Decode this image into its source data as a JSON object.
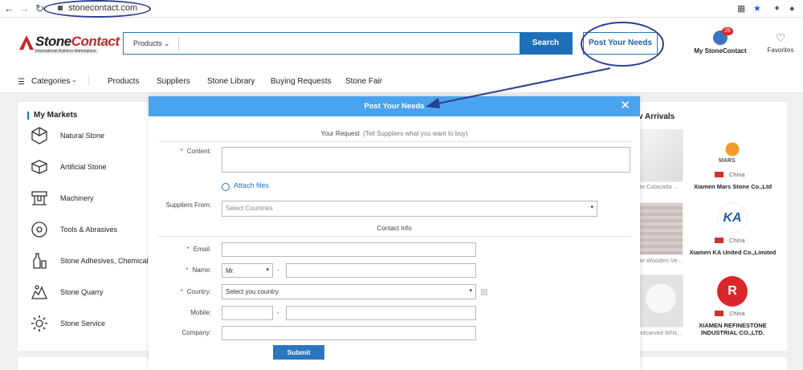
{
  "browser": {
    "url": "stonecontact.com",
    "back": "←",
    "forward": "→",
    "reload": "↻"
  },
  "header": {
    "logo_main": "Stone",
    "logo_accent": "Contact",
    "logo_tagline": "International Builders Marketplace",
    "search_category": "Products",
    "search_button": "Search",
    "post_needs": "Post Your Needs",
    "my_account": "My StoneContact",
    "account_badge": "26",
    "favorites": "Favorites"
  },
  "nav": {
    "categories": "Categories",
    "links": [
      "Products",
      "Suppliers",
      "Stone Library",
      "Buying Requests",
      "Stone Fair"
    ]
  },
  "markets": {
    "title": "My Markets",
    "items": [
      "Natural Stone",
      "Artificial Stone",
      "Machinery",
      "Tools & Abrasives",
      "Stone Adhesives, Chemicals",
      "Stone Quarry",
      "Stone Service"
    ]
  },
  "arrivals": {
    "title": "v Arrivals",
    "products": [
      "ite Calacatta ...",
      "ite Wooden Ve...",
      "ndcarved Whit..."
    ],
    "suppliers": [
      {
        "name": "Xiamen Mars Stone Co.,Ltd",
        "country": "China",
        "logo_text": "MARS"
      },
      {
        "name": "Xiamen KA United Co.,Limited",
        "country": "China",
        "logo_text": "KA"
      },
      {
        "name": "XIAMEN REFINESTONE INDUSTRIAL CO.,LTD.",
        "country": "China",
        "logo_text": "R"
      }
    ]
  },
  "modal": {
    "title": "Post Your Needs",
    "close": "✕",
    "request_section": "Your Request",
    "request_hint": "(Tell Suppliers what you want to buy)",
    "content_label": "Content:",
    "attach_files": "Attach files",
    "suppliers_from_label": "Suppliers From:",
    "suppliers_from_placeholder": "Select Countries",
    "contact_section": "Contact Info",
    "email_label": "Email:",
    "name_label": "Name:",
    "name_title": "Mr.",
    "country_label": "Country:",
    "country_placeholder": "Select you country",
    "mobile_label": "Mobile:",
    "company_label": "Company:",
    "dash": "-",
    "required_mark": "*",
    "submit": "Submit"
  },
  "colors": {
    "brand_blue": "#1b78c4",
    "modal_header": "#4aa3ee",
    "annotation": "#2b3f8f",
    "required": "#d9262c"
  }
}
